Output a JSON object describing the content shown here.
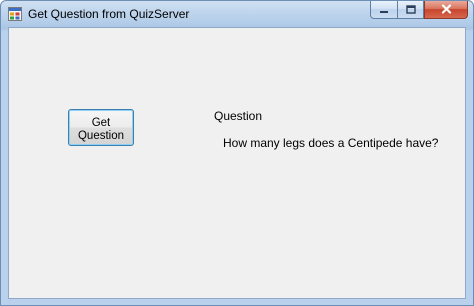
{
  "window": {
    "title": "Get Question from QuizServer",
    "controls": {
      "minimize": "minimize-icon",
      "maximize": "maximize-icon",
      "close": "close-icon"
    }
  },
  "form": {
    "get_button_label": "Get\nQuestion",
    "question_label": "Question",
    "question_text": "How many legs does a Centipede have?"
  },
  "colors": {
    "client_background": "#f0f0f0",
    "titlebar": "#bcd3ec",
    "close_button": "#c7452c",
    "button_focus_border": "#3c7fb1"
  }
}
